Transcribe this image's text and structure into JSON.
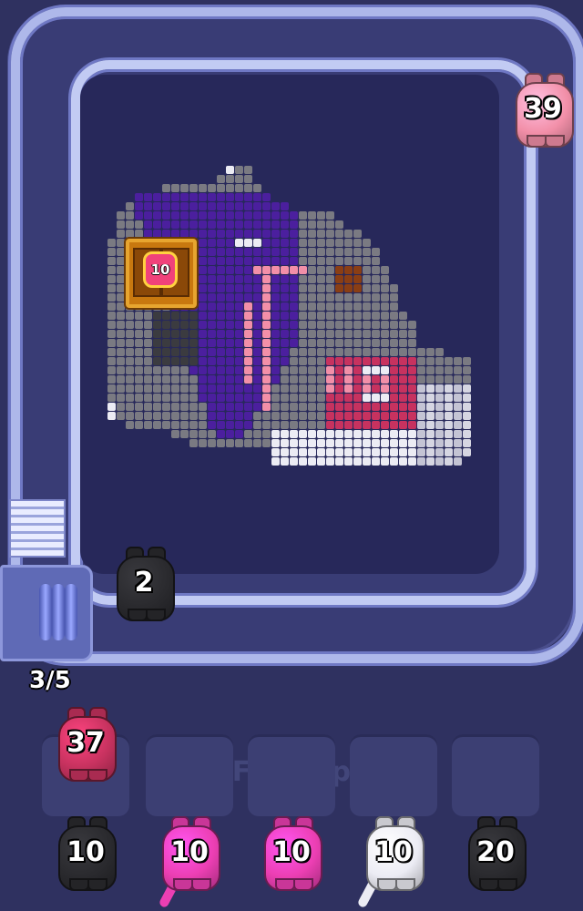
{
  "watermark": "Pixel-Flow.app",
  "level_progress": "3/5",
  "colors": {
    "background": "#2f3160",
    "rail": "#b9c2ef",
    "board": "#27285a",
    "pink": "#f28fa8",
    "crimson": "#c7325f",
    "magenta": "#ec3fb3",
    "black": "#2a2a2e",
    "white": "#ececf4",
    "purple": "#4b1f9e",
    "gray": "#7a7a82",
    "brown": "#8a3e14"
  },
  "conveyor_pigs": [
    {
      "label": "39",
      "color": "pink"
    },
    {
      "label": "2",
      "color": "black"
    }
  ],
  "crate": {
    "label": "10",
    "icon": "bomb-icon"
  },
  "holding_slots": [
    {
      "label": "37",
      "color": "crimson"
    },
    {
      "label": "",
      "color": null
    },
    {
      "label": "",
      "color": null
    },
    {
      "label": "",
      "color": null
    },
    {
      "label": "",
      "color": null
    }
  ],
  "queue_pigs": [
    {
      "label": "10",
      "color": "black"
    },
    {
      "label": "10",
      "color": "magenta"
    },
    {
      "label": "10",
      "color": "magenta"
    },
    {
      "label": "10",
      "color": "white"
    },
    {
      "label": "20",
      "color": "black"
    }
  ]
}
